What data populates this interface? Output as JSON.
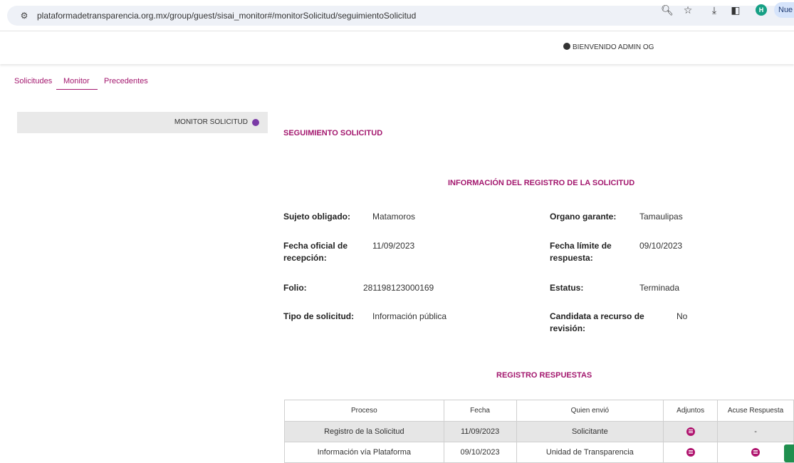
{
  "browser": {
    "url": "plataformadetransparencia.org.mx/group/guest/sisai_monitor#/monitorSolicitud/seguimientoSolicitud",
    "profile_initial": "H",
    "new_label": "Nue"
  },
  "header": {
    "welcome": "BIENVENIDO ADMIN OG"
  },
  "nav": {
    "items": [
      {
        "label": "Solicitudes"
      },
      {
        "label": "Monitor",
        "active": true
      },
      {
        "label": "Precedentes"
      }
    ]
  },
  "sidebar": {
    "items": [
      {
        "label": "MONITOR SOLICITUD"
      }
    ]
  },
  "main": {
    "title": "SEGUIMIENTO SOLICITUD",
    "info_section_title": "INFORMACIÓN DEL REGISTRO DE LA SOLICITUD",
    "fields": {
      "sujeto_label": "Sujeto obligado:",
      "sujeto_value": "Matamoros",
      "organo_label": "Organo garante:",
      "organo_value": "Tamaulipas",
      "fecha_oficial_label": "Fecha oficial de recepción:",
      "fecha_oficial_value": "11/09/2023",
      "fecha_limite_label": "Fecha límite de respuesta:",
      "fecha_limite_value": "09/10/2023",
      "folio_label": "Folio:",
      "folio_value": "281198123000169",
      "estatus_label": "Estatus:",
      "estatus_value": "Terminada",
      "tipo_label": "Tipo de solicitud:",
      "tipo_value": "Información pública",
      "candidata_label": "Candidata a recurso de revisión:",
      "candidata_value": "No"
    },
    "responses_title": "REGISTRO RESPUESTAS",
    "table": {
      "headers": [
        "Proceso",
        "Fecha",
        "Quien envió",
        "Adjuntos",
        "Acuse Respuesta"
      ],
      "rows": [
        {
          "proceso": "Registro de la Solicitud",
          "fecha": "11/09/2023",
          "quien": "Solicitante",
          "adjuntos": "document-icon",
          "acuse": "-"
        },
        {
          "proceso": "Información vía Plataforma",
          "fecha": "09/10/2023",
          "quien": "Unidad de Transparencia",
          "adjuntos": "document-icon",
          "acuse": "document-icon"
        }
      ]
    }
  },
  "colors": {
    "accent": "#a3176e",
    "icon_magenta": "#b0156f",
    "sidebar_dot": "#7a3aa6",
    "row_shade": "#e6e6e6"
  }
}
